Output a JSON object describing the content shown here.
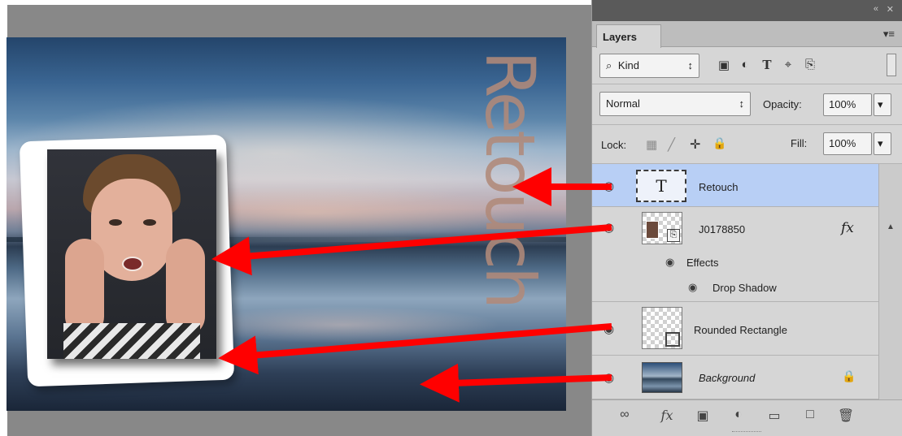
{
  "panel": {
    "tab_label": "Layers",
    "collapse_label": "«",
    "close_label": "✕",
    "menu_label": "▾≡",
    "filter": {
      "search_glyph": "⌕",
      "kind_label": "Kind",
      "stepper_glyph": "↕"
    },
    "blend_mode": "Normal",
    "opacity_label": "Opacity:",
    "opacity_value": "100%",
    "lock_label": "Lock:",
    "fill_label": "Fill:",
    "fill_value": "100%",
    "dropdown_glyph": "▾"
  },
  "layers": [
    {
      "name": "Retouch",
      "type": "text",
      "thumb_glyph": "T",
      "selected": true
    },
    {
      "name": "J0178850",
      "type": "smart-object",
      "fx_label": "fx",
      "effects_label": "Effects",
      "effect_items": [
        "Drop Shadow"
      ]
    },
    {
      "name": "Rounded Rectangle",
      "type": "shape"
    },
    {
      "name": "Background",
      "type": "image",
      "locked": true
    }
  ],
  "canvas": {
    "text_layer_content": "Retouch"
  },
  "colors": {
    "selected_row": "#b8cff5",
    "panel_bg": "#d6d6d6",
    "arrow": "#ff0000",
    "text_layer": "#b18a7a"
  },
  "icons": {
    "eye": "◉",
    "lock": "🔒",
    "image_filter": "▣",
    "adjust_filter": "◐",
    "type_filter": "T",
    "shape_filter": "⌖",
    "smart_filter": "⎘",
    "link": "∞",
    "fx": "fx",
    "mask": "▣",
    "adjustment": "◐",
    "folder": "▭",
    "new_layer": "□",
    "trash": "🗑",
    "move": "✛",
    "brush": "╱",
    "pixels": "▦"
  }
}
